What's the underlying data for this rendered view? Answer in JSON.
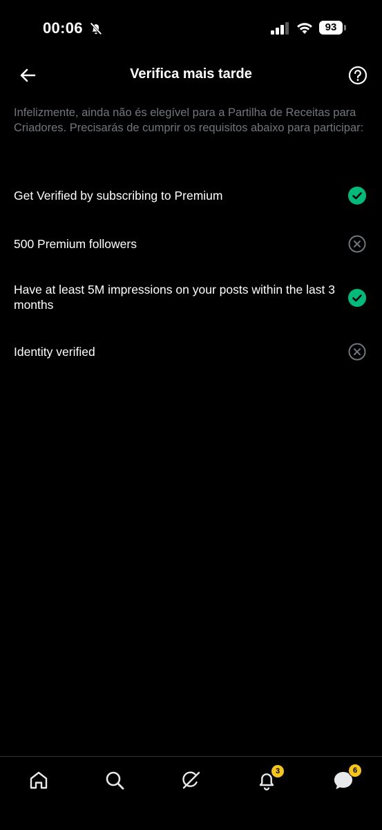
{
  "status_bar": {
    "time": "00:06",
    "battery": "93",
    "icons": [
      "bell-off-icon",
      "signal-icon",
      "wifi-icon",
      "battery-icon"
    ]
  },
  "header": {
    "title": "Verifica mais tarde",
    "back_icon": "arrow-left-icon",
    "help_icon": "question-circle-icon"
  },
  "description": "Infelizmente, ainda não és elegível para a Partilha de Receitas para Criadores. Precisarás de cumprir os requisitos abaixo para participar:",
  "requirements": [
    {
      "label": "Get Verified by subscribing to Premium",
      "status": "met"
    },
    {
      "label": "500 Premium followers",
      "status": "unmet"
    },
    {
      "label": "Have at least 5M impressions on your posts within the last 3 months",
      "status": "met"
    },
    {
      "label": "Identity verified",
      "status": "unmet"
    }
  ],
  "colors": {
    "met": "#00ba7c",
    "unmet": "#71767b",
    "badge": "#f5c518"
  },
  "bottom_nav": {
    "items": [
      {
        "icon": "home-icon"
      },
      {
        "icon": "search-icon"
      },
      {
        "icon": "grok-icon"
      },
      {
        "icon": "bell-icon",
        "badge": "3"
      },
      {
        "icon": "messages-icon",
        "badge": "6"
      }
    ]
  }
}
